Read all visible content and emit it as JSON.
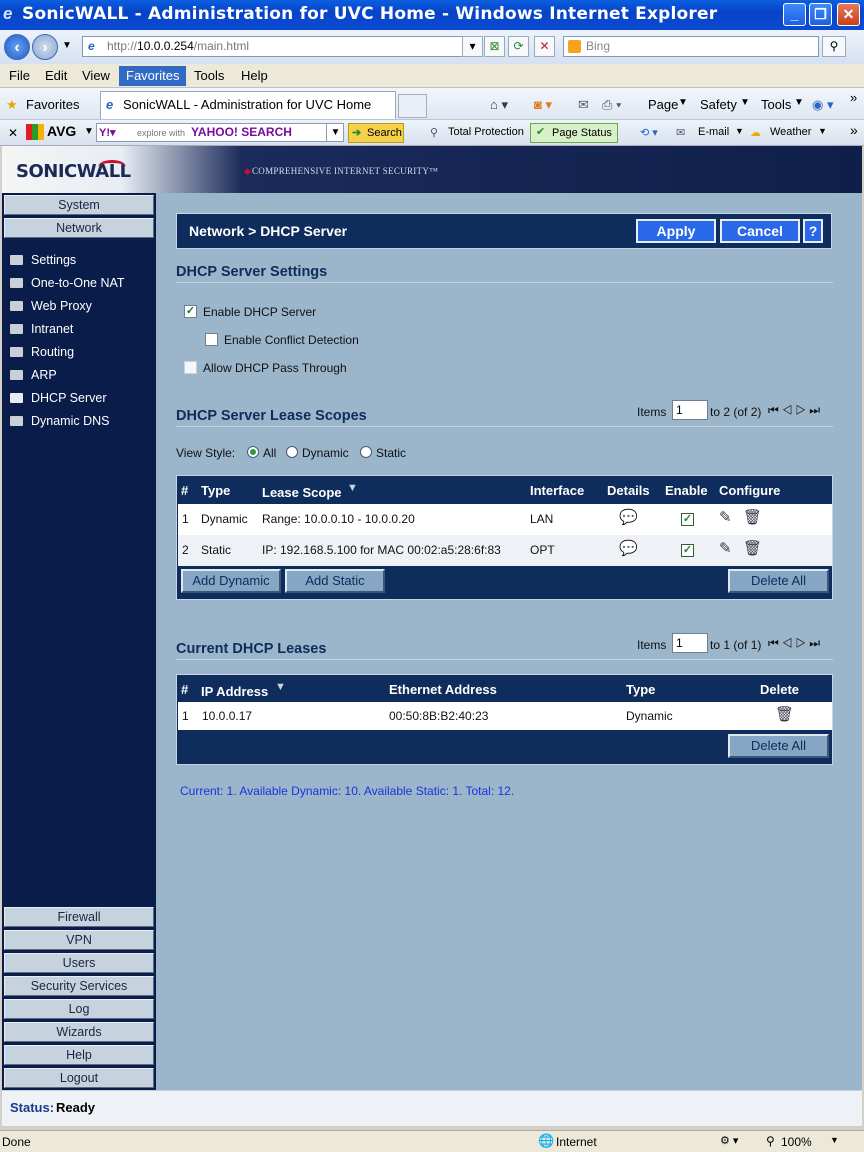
{
  "window": {
    "title": "SonicWALL - Administration for UVC Home - Windows Internet Explorer",
    "min": "_",
    "max": "❐",
    "close": "✕"
  },
  "addressbar": {
    "url_prefix": "http://",
    "url_host": "10.0.0.254",
    "url_path": "/main.html",
    "search_placeholder": "Bing"
  },
  "menubar": {
    "file": "File",
    "edit": "Edit",
    "view": "View",
    "favorites": "Favorites",
    "tools": "Tools",
    "help": "Help"
  },
  "favbar": {
    "favorites": "Favorites",
    "tab_title": "SonicWALL - Administration for UVC Home",
    "page": "Page",
    "safety": "Safety",
    "tools": "Tools"
  },
  "avgbar": {
    "avg": "AVG",
    "yahoo_explore": "explore with",
    "yahoo": "YAHOO! SEARCH",
    "search": "Search",
    "total_protection": "Total Protection",
    "page_status": "Page Status",
    "email": "E-mail",
    "weather": "Weather"
  },
  "sonicwall": {
    "logo": "SONICWALL",
    "tagline": "COMPREHENSIVE INTERNET SECURITY™"
  },
  "sidebar": {
    "top": [
      "System",
      "Network"
    ],
    "nav": [
      "Settings",
      "One-to-One NAT",
      "Web Proxy",
      "Intranet",
      "Routing",
      "ARP",
      "DHCP Server",
      "Dynamic DNS"
    ],
    "bottom": [
      "Firewall",
      "VPN",
      "Users",
      "Security Services",
      "Log",
      "Wizards",
      "Help",
      "Logout"
    ]
  },
  "page": {
    "title": "Network > DHCP Server",
    "apply": "Apply",
    "cancel": "Cancel",
    "help": "?"
  },
  "settings": {
    "heading": "DHCP Server Settings",
    "enable_dhcp": "Enable DHCP Server",
    "conflict": "Enable Conflict Detection",
    "pass_through": "Allow DHCP Pass Through"
  },
  "scopes": {
    "heading": "DHCP Server Lease Scopes",
    "items_label": "Items",
    "items_value": "1",
    "items_range": "to 2 (of 2)",
    "view_style": "View Style:",
    "view_all": "All",
    "view_dynamic": "Dynamic",
    "view_static": "Static",
    "columns": [
      "#",
      "Type",
      "Lease Scope",
      "Interface",
      "Details",
      "Enable",
      "Configure"
    ],
    "rows": [
      {
        "num": "1",
        "type": "Dynamic",
        "scope": "Range: 10.0.0.10 - 10.0.0.20",
        "iface": "LAN"
      },
      {
        "num": "2",
        "type": "Static",
        "scope": "IP: 192.168.5.100 for MAC 00:02:a5:28:6f:83",
        "iface": "OPT"
      }
    ],
    "add_dynamic": "Add Dynamic",
    "add_static": "Add Static",
    "delete_all": "Delete All"
  },
  "leases": {
    "heading": "Current DHCP Leases",
    "items_label": "Items",
    "items_value": "1",
    "items_range": "to 1 (of 1)",
    "columns": [
      "#",
      "IP Address",
      "Ethernet Address",
      "Type",
      "Delete"
    ],
    "rows": [
      {
        "num": "1",
        "ip": "10.0.0.17",
        "mac": "00:50:8B:B2:40:23",
        "type": "Dynamic"
      }
    ],
    "delete_all": "Delete All"
  },
  "summary": "Current: 1. Available Dynamic: 10. Available Static: 1. Total: 12.",
  "status": {
    "label": "Status:",
    "value": "Ready"
  },
  "iestatus": {
    "done": "Done",
    "zone": "Internet",
    "zoom": "100%"
  }
}
